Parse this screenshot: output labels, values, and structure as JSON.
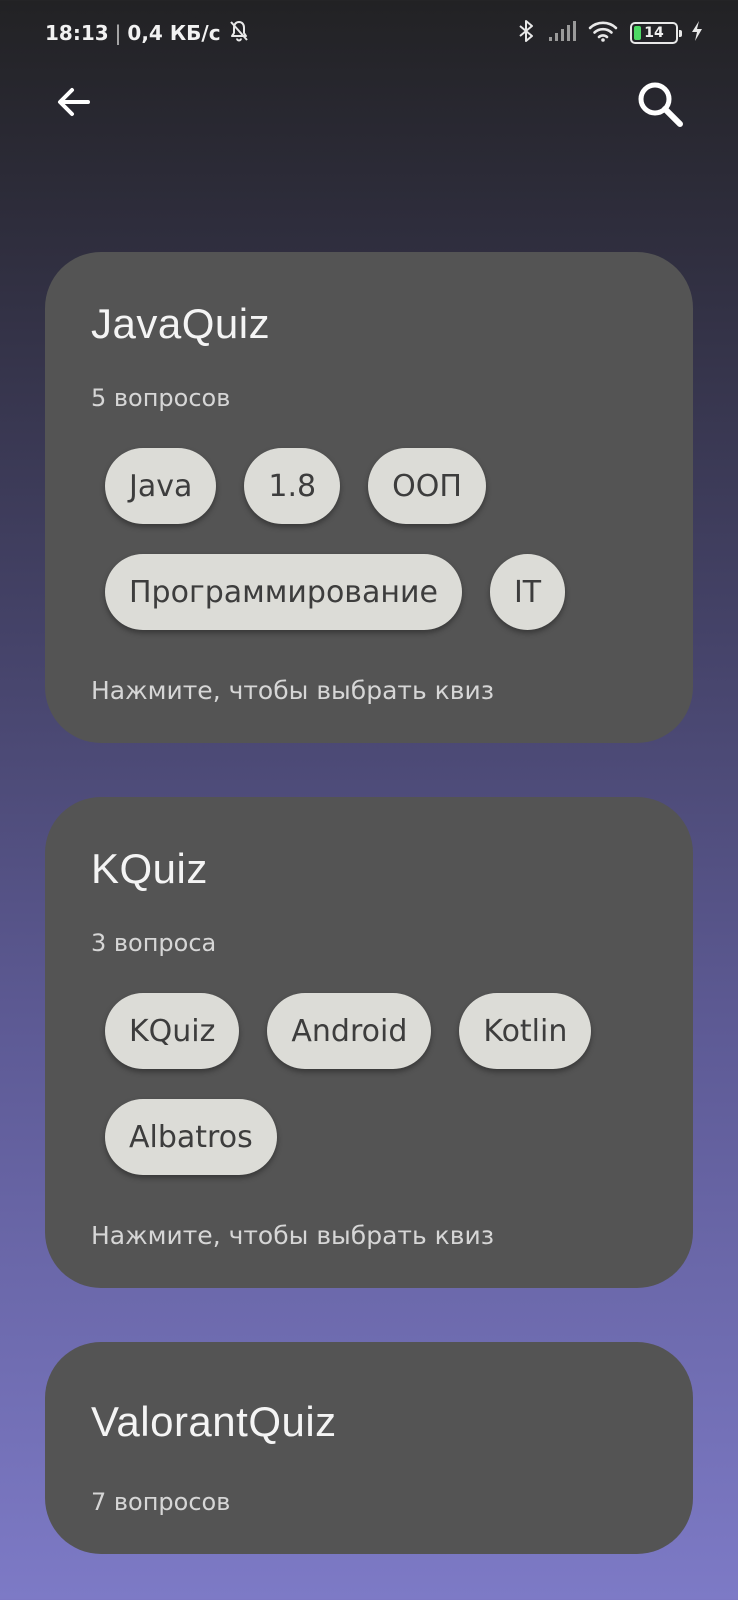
{
  "status_bar": {
    "time": "18:13",
    "separator": "|",
    "network_speed": "0,4 КБ/с",
    "battery_level": "14",
    "icons": [
      "mute-bell-icon",
      "bluetooth-icon",
      "signal-icon",
      "wifi-icon",
      "battery-icon",
      "charging-icon"
    ]
  },
  "toolbar": {
    "back_icon": "arrow-left-icon",
    "search_icon": "search-icon"
  },
  "colors": {
    "card_background": "#545454",
    "tag_background": "#dcdcd7",
    "tag_text": "#3d3d3d",
    "gradient_top": "#222224",
    "gradient_bottom": "#7d7ac6"
  },
  "quizzes": [
    {
      "title": "JavaQuiz",
      "count": "5 вопросов",
      "tags": [
        "Java",
        "1.8",
        "ООП",
        "Программирование",
        "IT"
      ],
      "hint": "Нажмите, чтобы выбрать квиз"
    },
    {
      "title": "KQuiz",
      "count": "3 вопроса",
      "tags": [
        "KQuiz",
        "Android",
        "Kotlin",
        "Albatros"
      ],
      "hint": "Нажмите, чтобы выбрать квиз"
    },
    {
      "title": "ValorantQuiz",
      "count": "7 вопросов",
      "tags": [],
      "hint": ""
    }
  ]
}
